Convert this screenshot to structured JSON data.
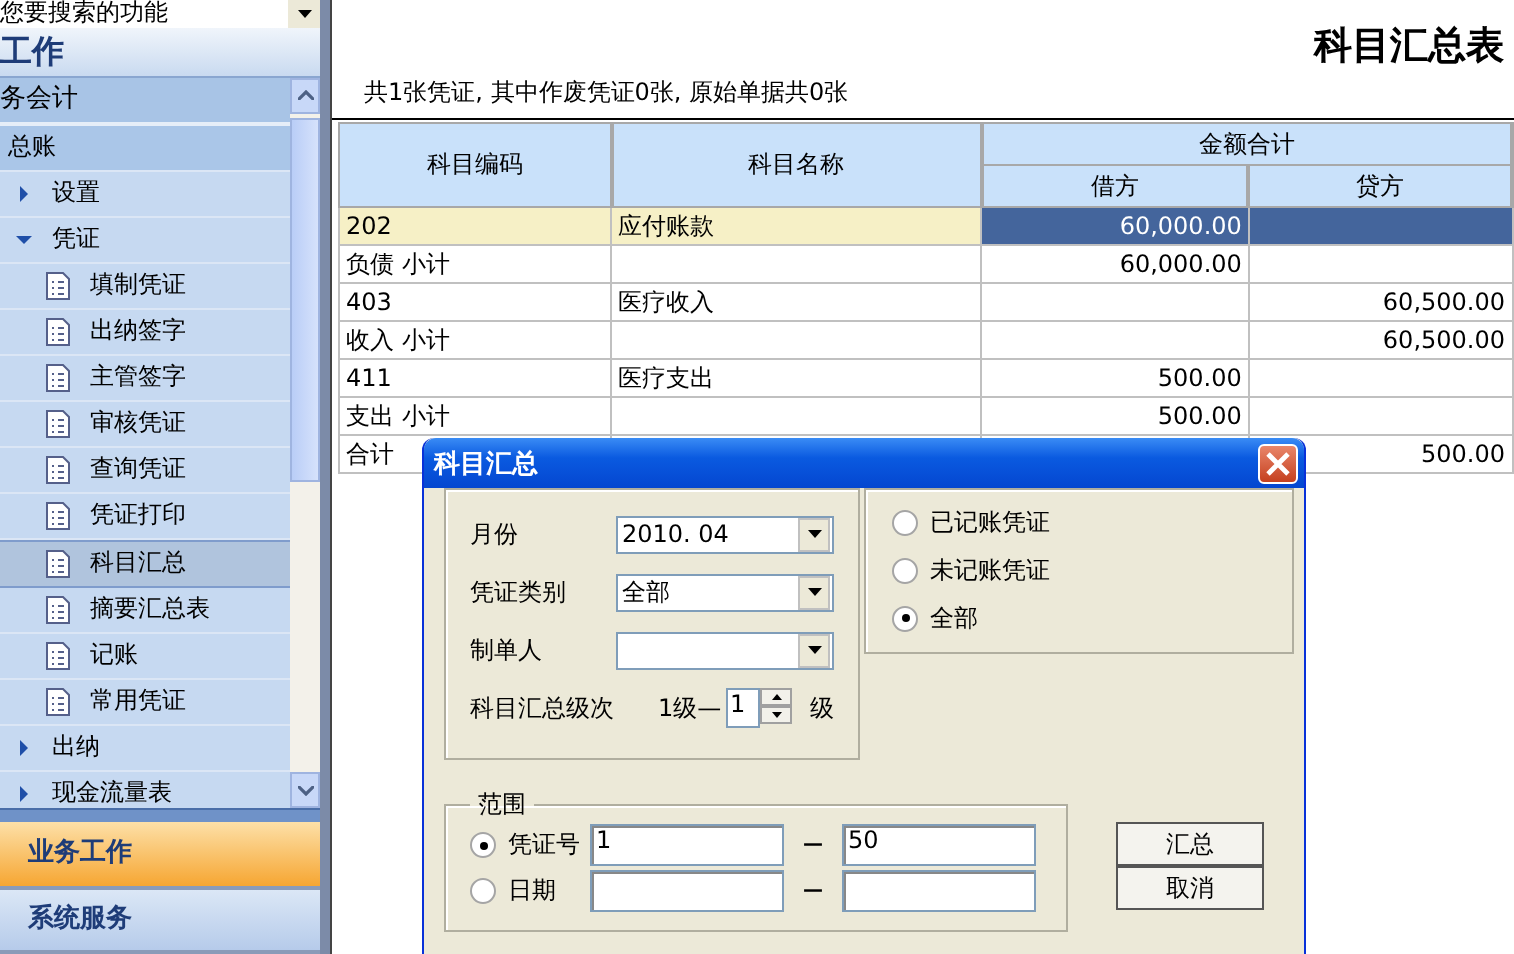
{
  "search": {
    "value": "您要搜索的功能"
  },
  "sidebar": {
    "header": "工作",
    "section": "务会计",
    "tree": [
      {
        "label": "总账",
        "kind": "group",
        "selected": false,
        "children": [
          {
            "label": "设置",
            "kind": "folder",
            "expanded": false,
            "selected": false
          },
          {
            "label": "凭证",
            "kind": "folder",
            "expanded": true,
            "selected": false,
            "children": [
              {
                "label": "填制凭证",
                "kind": "leaf",
                "selected": false
              },
              {
                "label": "出纳签字",
                "kind": "leaf",
                "selected": false
              },
              {
                "label": "主管签字",
                "kind": "leaf",
                "selected": false
              },
              {
                "label": "审核凭证",
                "kind": "leaf",
                "selected": false
              },
              {
                "label": "查询凭证",
                "kind": "leaf",
                "selected": false
              },
              {
                "label": "凭证打印",
                "kind": "leaf",
                "selected": false
              },
              {
                "label": "科目汇总",
                "kind": "leaf",
                "selected": true
              },
              {
                "label": "摘要汇总表",
                "kind": "leaf",
                "selected": false
              },
              {
                "label": "记账",
                "kind": "leaf",
                "selected": false
              },
              {
                "label": "常用凭证",
                "kind": "leaf",
                "selected": false
              }
            ]
          },
          {
            "label": "出纳",
            "kind": "folder",
            "expanded": false,
            "selected": false
          },
          {
            "label": "现金流量表",
            "kind": "folder",
            "expanded": false,
            "selected": false
          }
        ]
      }
    ],
    "bottom": [
      {
        "label": "业务工作",
        "selected": true
      },
      {
        "label": "系统服务",
        "selected": false
      }
    ]
  },
  "report": {
    "title": "科目汇总表",
    "summary": "共1张凭证, 其中作废凭证0张, 原始单据共0张",
    "columns": {
      "code": "科目编码",
      "name": "科目名称",
      "amount": "金额合计",
      "debit": "借方",
      "credit": "贷方"
    },
    "rows": [
      {
        "code": "202",
        "name": "应付账款",
        "debit": "60,000.00",
        "selected": true
      },
      {
        "code": "负债 小计",
        "debit": "60,000.00",
        "selected": false
      },
      {
        "code": "403",
        "name": "医疗收入",
        "credit": "60,500.00",
        "selected": false
      },
      {
        "code": "收入 小计",
        "credit": "60,500.00",
        "selected": false
      },
      {
        "code": "411",
        "name": "医疗支出",
        "debit": "500.00",
        "selected": false
      },
      {
        "code": "支出 小计",
        "debit": "500.00",
        "selected": false
      },
      {
        "code": "合计",
        "credit": "500.00",
        "selected": false
      }
    ]
  },
  "dialog": {
    "title": "科目汇总",
    "fields": [
      {
        "label": "月份",
        "value": "2010. 04"
      },
      {
        "label": "凭证类别",
        "value": "全部"
      },
      {
        "label": "制单人"
      }
    ],
    "level": {
      "label": "科目汇总级次",
      "prefix": "1级—",
      "value": "1",
      "suffix": "级"
    },
    "status": [
      {
        "label": "已记账凭证",
        "selected": false
      },
      {
        "label": "未记账凭证",
        "selected": false
      },
      {
        "label": "全部",
        "selected": true
      }
    ],
    "range": {
      "legend": "范围",
      "rows": [
        {
          "label": "凭证号",
          "selected": true,
          "from": "1",
          "dash": "—",
          "to": "50"
        },
        {
          "label": "日期",
          "selected": false,
          "dash": "—"
        }
      ]
    },
    "buttons": [
      "汇总",
      "取消"
    ]
  }
}
